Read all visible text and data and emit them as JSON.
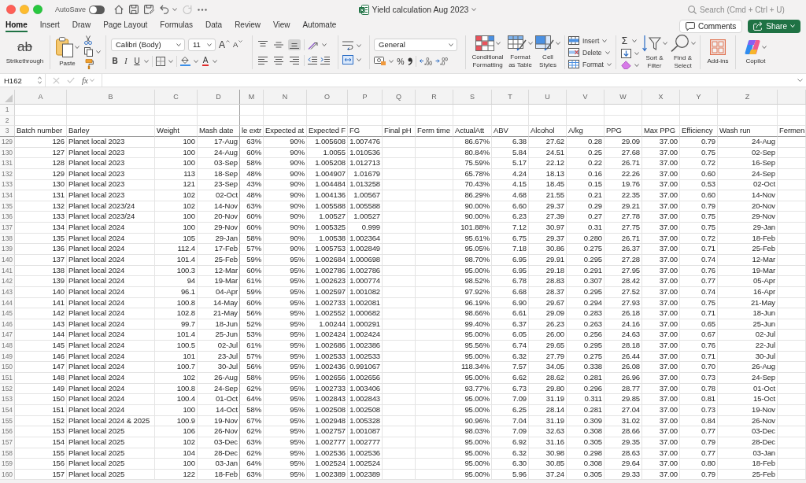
{
  "window": {
    "title": "Yield calculation Aug 2023",
    "autosave": {
      "label": "AutoSave",
      "on": false
    },
    "undo": {
      "disabled": false
    },
    "redo": {
      "disabled": true
    },
    "search": {
      "placeholder": "Search (Cmd + Ctrl + U)"
    }
  },
  "tabs": [
    {
      "label": "Home",
      "selected": true
    },
    {
      "label": "Insert",
      "selected": false
    },
    {
      "label": "Draw",
      "selected": false
    },
    {
      "label": "Page Layout",
      "selected": false
    },
    {
      "label": "Formulas",
      "selected": false
    },
    {
      "label": "Data",
      "selected": false
    },
    {
      "label": "Review",
      "selected": false
    },
    {
      "label": "View",
      "selected": false
    },
    {
      "label": "Automate",
      "selected": false
    }
  ],
  "header_buttons": [
    {
      "label": "Comments",
      "kind": "outline"
    },
    {
      "label": "Share",
      "kind": "primary"
    }
  ],
  "ribbon": {
    "strikethrough": {
      "glyph": "ab",
      "label": "Strikethrough"
    },
    "clipboard": {
      "paste_label": "Paste"
    },
    "font": {
      "name": "Calibri (Body)",
      "size": "11",
      "grow_glyph": "A",
      "shrink_glyph": "A",
      "bold_glyph": "B",
      "italic_glyph": "I",
      "underline_glyph": "U",
      "color_glyph": "A"
    },
    "alignment": {
      "vertical": [
        {
          "kind": "top",
          "selected": false
        },
        {
          "kind": "middle",
          "selected": false
        },
        {
          "kind": "bottom",
          "selected": true
        }
      ],
      "horizontal": [
        {
          "kind": "left",
          "selected": false
        },
        {
          "kind": "center",
          "selected": false
        },
        {
          "kind": "right",
          "selected": false
        }
      ]
    },
    "number": {
      "format": "General",
      "percent_glyph": "%"
    },
    "styles": [
      {
        "kind": "conditional",
        "label": "Conditional Formatting"
      },
      {
        "kind": "table",
        "label": "Format as Table"
      },
      {
        "kind": "cell",
        "label": "Cell Styles"
      }
    ],
    "cells": [
      {
        "kind": "insert",
        "label": "Insert"
      },
      {
        "kind": "delete",
        "label": "Delete"
      },
      {
        "kind": "format",
        "label": "Format"
      }
    ],
    "editing": {
      "autosum_glyph": "Σ",
      "sort_label": "Sort & Filter",
      "find_label": "Find & Select"
    },
    "add_ins": {
      "label": "Add-ins"
    },
    "copilot": {
      "label": "Copilot"
    }
  },
  "formula_bar": {
    "name_box": "H162",
    "cancel": {
      "disabled": true
    },
    "enter": {
      "disabled": true
    },
    "function_label": "fx"
  },
  "sheet": {
    "columns": {
      "frozen": [
        {
          "letter": "A",
          "kind": "number"
        },
        {
          "letter": "B",
          "kind": "text"
        },
        {
          "letter": "C",
          "kind": "number"
        },
        {
          "letter": "D",
          "kind": "number"
        }
      ],
      "scrolling": [
        {
          "letter": "M",
          "kind": "number"
        },
        {
          "letter": "N",
          "kind": "number"
        },
        {
          "letter": "O",
          "kind": "number"
        },
        {
          "letter": "P",
          "kind": "number"
        },
        {
          "letter": "Q"
        },
        {
          "letter": "R"
        },
        {
          "letter": "S",
          "kind": "number"
        },
        {
          "letter": "T",
          "kind": "number"
        },
        {
          "letter": "U",
          "kind": "number"
        },
        {
          "letter": "V",
          "kind": "number"
        },
        {
          "letter": "W",
          "kind": "number"
        },
        {
          "letter": "X",
          "kind": "number"
        },
        {
          "letter": "Y",
          "kind": "number"
        },
        {
          "letter": "Z",
          "kind": "number"
        }
      ]
    },
    "blank_rows": [
      {
        "number": "1"
      },
      {
        "number": "2"
      }
    ],
    "header_row": {
      "number": "3",
      "cells": [
        "Batch number",
        "Barley",
        "Weight",
        "Mash date",
        "le extr",
        "Expected at",
        "Expected F",
        "FG",
        "Final pH",
        "Ferm time",
        "ActualAtt",
        "ABV",
        "Alcohol",
        "A/kg",
        "PPG",
        "Max PPG",
        "Efficiency",
        "Wash run",
        "Fermen"
      ]
    },
    "rows": [
      {
        "number": "129",
        "cells": [
          "126",
          "Planet local 2023",
          "100",
          "17-Aug",
          "63%",
          "90%",
          "1.005608",
          "1.007476",
          null,
          null,
          "86.67%",
          "6.38",
          "27.62",
          "0.28",
          "29.09",
          "37.00",
          "0.79",
          "24-Aug"
        ]
      },
      {
        "number": "130",
        "cells": [
          "127",
          "Planet local 2023",
          "100",
          "24-Aug",
          "60%",
          "90%",
          "1.0055",
          "1.010536",
          null,
          null,
          "80.84%",
          "5.84",
          "24.51",
          "0.25",
          "27.68",
          "37.00",
          "0.75",
          "02-Sep"
        ]
      },
      {
        "number": "131",
        "cells": [
          "128",
          "Planet local 2023",
          "100",
          "03-Sep",
          "58%",
          "90%",
          "1.005208",
          "1.012713",
          null,
          null,
          "75.59%",
          "5.17",
          "22.12",
          "0.22",
          "26.71",
          "37.00",
          "0.72",
          "16-Sep"
        ]
      },
      {
        "number": "132",
        "cells": [
          "129",
          "Planet local 2023",
          "113",
          "18-Sep",
          "48%",
          "90%",
          "1.004907",
          "1.01679",
          null,
          null,
          "65.78%",
          "4.24",
          "18.13",
          "0.16",
          "22.26",
          "37.00",
          "0.60",
          "24-Sep"
        ]
      },
      {
        "number": "133",
        "cells": [
          "130",
          "Planet local 2023",
          "121",
          "23-Sep",
          "43%",
          "90%",
          "1.004484",
          "1.013258",
          null,
          null,
          "70.43%",
          "4.15",
          "18.45",
          "0.15",
          "19.76",
          "37.00",
          "0.53",
          "02-Oct"
        ]
      },
      {
        "number": "134",
        "cells": [
          "131",
          "Planet local 2023",
          "102",
          "02-Oct",
          "48%",
          "90%",
          "1.004136",
          "1.00567",
          null,
          null,
          "86.29%",
          "4.68",
          "21.55",
          "0.21",
          "22.35",
          "37.00",
          "0.60",
          "14-Nov"
        ]
      },
      {
        "number": "135",
        "cells": [
          "132",
          "Planet local 2023/24",
          "102",
          "14-Nov",
          "63%",
          "90%",
          "1.005588",
          "1.005588",
          null,
          null,
          "90.00%",
          "6.60",
          "29.37",
          "0.29",
          "29.21",
          "37.00",
          "0.79",
          "20-Nov"
        ]
      },
      {
        "number": "136",
        "cells": [
          "133",
          "Planet local 2023/24",
          "100",
          "20-Nov",
          "60%",
          "90%",
          "1.00527",
          "1.00527",
          null,
          null,
          "90.00%",
          "6.23",
          "27.39",
          "0.27",
          "27.78",
          "37.00",
          "0.75",
          "29-Nov"
        ]
      },
      {
        "number": "137",
        "cells": [
          "134",
          "Planet local 2024",
          "100",
          "29-Nov",
          "60%",
          "90%",
          "1.005325",
          "0.999",
          null,
          null,
          "101.88%",
          "7.12",
          "30.97",
          "0.31",
          "27.75",
          "37.00",
          "0.75",
          "29-Jan"
        ]
      },
      {
        "number": "138",
        "cells": [
          "135",
          "Planet local 2024",
          "105",
          "29-Jan",
          "58%",
          "90%",
          "1.00538",
          "1.002364",
          null,
          null,
          "95.61%",
          "6.75",
          "29.37",
          "0.280",
          "26.71",
          "37.00",
          "0.72",
          "18-Feb"
        ]
      },
      {
        "number": "139",
        "cells": [
          "136",
          "Planet local 2024",
          "112.4",
          "17-Feb",
          "57%",
          "90%",
          "1.005753",
          "1.002849",
          null,
          null,
          "95.05%",
          "7.18",
          "30.86",
          "0.275",
          "26.37",
          "37.00",
          "0.71",
          "25-Feb"
        ]
      },
      {
        "number": "140",
        "cells": [
          "137",
          "Planet local 2024",
          "101.4",
          "25-Feb",
          "59%",
          "95%",
          "1.002684",
          "1.000698",
          null,
          null,
          "98.70%",
          "6.95",
          "29.91",
          "0.295",
          "27.28",
          "37.00",
          "0.74",
          "12-Mar"
        ]
      },
      {
        "number": "141",
        "cells": [
          "138",
          "Planet local 2024",
          "100.3",
          "12-Mar",
          "60%",
          "95%",
          "1.002786",
          "1.002786",
          null,
          null,
          "95.00%",
          "6.95",
          "29.18",
          "0.291",
          "27.95",
          "37.00",
          "0.76",
          "19-Mar"
        ]
      },
      {
        "number": "142",
        "cells": [
          "139",
          "Planet local 2024",
          "94",
          "19-Mar",
          "61%",
          "95%",
          "1.002623",
          "1.000774",
          null,
          null,
          "98.52%",
          "6.78",
          "28.83",
          "0.307",
          "28.42",
          "37.00",
          "0.77",
          "05-Apr"
        ]
      },
      {
        "number": "143",
        "cells": [
          "140",
          "Planet local 2024",
          "96.1",
          "04-Apr",
          "59%",
          "95%",
          "1.002597",
          "1.001082",
          null,
          null,
          "97.92%",
          "6.68",
          "28.37",
          "0.295",
          "27.52",
          "37.00",
          "0.74",
          "16-Apr"
        ]
      },
      {
        "number": "144",
        "cells": [
          "141",
          "Planet local 2024",
          "100.8",
          "14-May",
          "60%",
          "95%",
          "1.002733",
          "1.002081",
          null,
          null,
          "96.19%",
          "6.90",
          "29.67",
          "0.294",
          "27.93",
          "37.00",
          "0.75",
          "21-May"
        ]
      },
      {
        "number": "145",
        "cells": [
          "142",
          "Planet local 2024",
          "102.8",
          "21-May",
          "56%",
          "95%",
          "1.002552",
          "1.000682",
          null,
          null,
          "98.66%",
          "6.61",
          "29.09",
          "0.283",
          "26.18",
          "37.00",
          "0.71",
          "18-Jun"
        ]
      },
      {
        "number": "146",
        "cells": [
          "143",
          "Planet local 2024",
          "99.7",
          "18-Jun",
          "52%",
          "95%",
          "1.00244",
          "1.000291",
          null,
          null,
          "99.40%",
          "6.37",
          "26.23",
          "0.263",
          "24.16",
          "37.00",
          "0.65",
          "25-Jun"
        ]
      },
      {
        "number": "147",
        "cells": [
          "144",
          "Planet local 2024",
          "101.4",
          "25-Jun",
          "53%",
          "95%",
          "1.002424",
          "1.002424",
          null,
          null,
          "95.00%",
          "6.05",
          "26.00",
          "0.256",
          "24.63",
          "37.00",
          "0.67",
          "02-Jul"
        ]
      },
      {
        "number": "148",
        "cells": [
          "145",
          "Planet local 2024",
          "100.5",
          "02-Jul",
          "61%",
          "95%",
          "1.002686",
          "1.002386",
          null,
          null,
          "95.56%",
          "6.74",
          "29.65",
          "0.295",
          "28.18",
          "37.00",
          "0.76",
          "22-Jul"
        ]
      },
      {
        "number": "149",
        "cells": [
          "146",
          "Planet local 2024",
          "101",
          "23-Jul",
          "57%",
          "95%",
          "1.002533",
          "1.002533",
          null,
          null,
          "95.00%",
          "6.32",
          "27.79",
          "0.275",
          "26.44",
          "37.00",
          "0.71",
          "30-Jul"
        ]
      },
      {
        "number": "150",
        "cells": [
          "147",
          "Planet local 2024",
          "100.7",
          "30-Jul",
          "56%",
          "95%",
          "1.002436",
          "0.991067",
          null,
          null,
          "118.34%",
          "7.57",
          "34.05",
          "0.338",
          "26.08",
          "37.00",
          "0.70",
          "26-Aug"
        ]
      },
      {
        "number": "151",
        "cells": [
          "148",
          "Planet local 2024",
          "102",
          "26-Aug",
          "58%",
          "95%",
          "1.002656",
          "1.002656",
          null,
          null,
          "95.00%",
          "6.62",
          "28.62",
          "0.281",
          "26.96",
          "37.00",
          "0.73",
          "24-Sep"
        ]
      },
      {
        "number": "152",
        "cells": [
          "149",
          "Planet local 2024",
          "100.8",
          "24-Sep",
          "62%",
          "95%",
          "1.002733",
          "1.003406",
          null,
          null,
          "93.77%",
          "6.73",
          "29.80",
          "0.296",
          "28.77",
          "37.00",
          "0.78",
          "01-Oct"
        ]
      },
      {
        "number": "153",
        "cells": [
          "150",
          "Planet local 2024",
          "100.4",
          "01-Oct",
          "64%",
          "95%",
          "1.002843",
          "1.002843",
          null,
          null,
          "95.00%",
          "7.09",
          "31.19",
          "0.311",
          "29.85",
          "37.00",
          "0.81",
          "15-Oct"
        ]
      },
      {
        "number": "154",
        "cells": [
          "151",
          "Planet local 2024",
          "100",
          "14-Oct",
          "58%",
          "95%",
          "1.002508",
          "1.002508",
          null,
          null,
          "95.00%",
          "6.25",
          "28.14",
          "0.281",
          "27.04",
          "37.00",
          "0.73",
          "19-Nov"
        ]
      },
      {
        "number": "155",
        "cells": [
          "152",
          "Planet local 2024 & 2025",
          "100.9",
          "19-Nov",
          "67%",
          "95%",
          "1.002948",
          "1.005328",
          null,
          null,
          "90.96%",
          "7.04",
          "31.19",
          "0.309",
          "31.02",
          "37.00",
          "0.84",
          "26-Nov"
        ]
      },
      {
        "number": "156",
        "cells": [
          "153",
          "Planet local 2025",
          "106",
          "26-Nov",
          "62%",
          "95%",
          "1.002757",
          "1.001087",
          null,
          null,
          "98.03%",
          "7.09",
          "32.63",
          "0.308",
          "28.66",
          "37.00",
          "0.77",
          "03-Dec"
        ]
      },
      {
        "number": "157",
        "cells": [
          "154",
          "Planet local 2025",
          "102",
          "03-Dec",
          "63%",
          "95%",
          "1.002777",
          "1.002777",
          null,
          null,
          "95.00%",
          "6.92",
          "31.16",
          "0.305",
          "29.35",
          "37.00",
          "0.79",
          "28-Dec"
        ]
      },
      {
        "number": "158",
        "cells": [
          "155",
          "Planet local 2025",
          "104",
          "28-Dec",
          "62%",
          "95%",
          "1.002536",
          "1.002536",
          null,
          null,
          "95.00%",
          "6.32",
          "30.98",
          "0.298",
          "28.63",
          "37.00",
          "0.77",
          "03-Jan"
        ]
      },
      {
        "number": "159",
        "cells": [
          "156",
          "Planet local 2025",
          "100",
          "03-Jan",
          "64%",
          "95%",
          "1.002524",
          "1.002524",
          null,
          null,
          "95.00%",
          "6.30",
          "30.85",
          "0.308",
          "29.64",
          "37.00",
          "0.80",
          "18-Feb"
        ]
      },
      {
        "number": "160",
        "cells": [
          "157",
          "Planet local 2025",
          "122",
          "18-Feb",
          "63%",
          "95%",
          "1.002389",
          "1.002389",
          null,
          null,
          "95.00%",
          "5.96",
          "37.24",
          "0.305",
          "29.33",
          "37.00",
          "0.79",
          "25-Feb"
        ]
      }
    ]
  }
}
